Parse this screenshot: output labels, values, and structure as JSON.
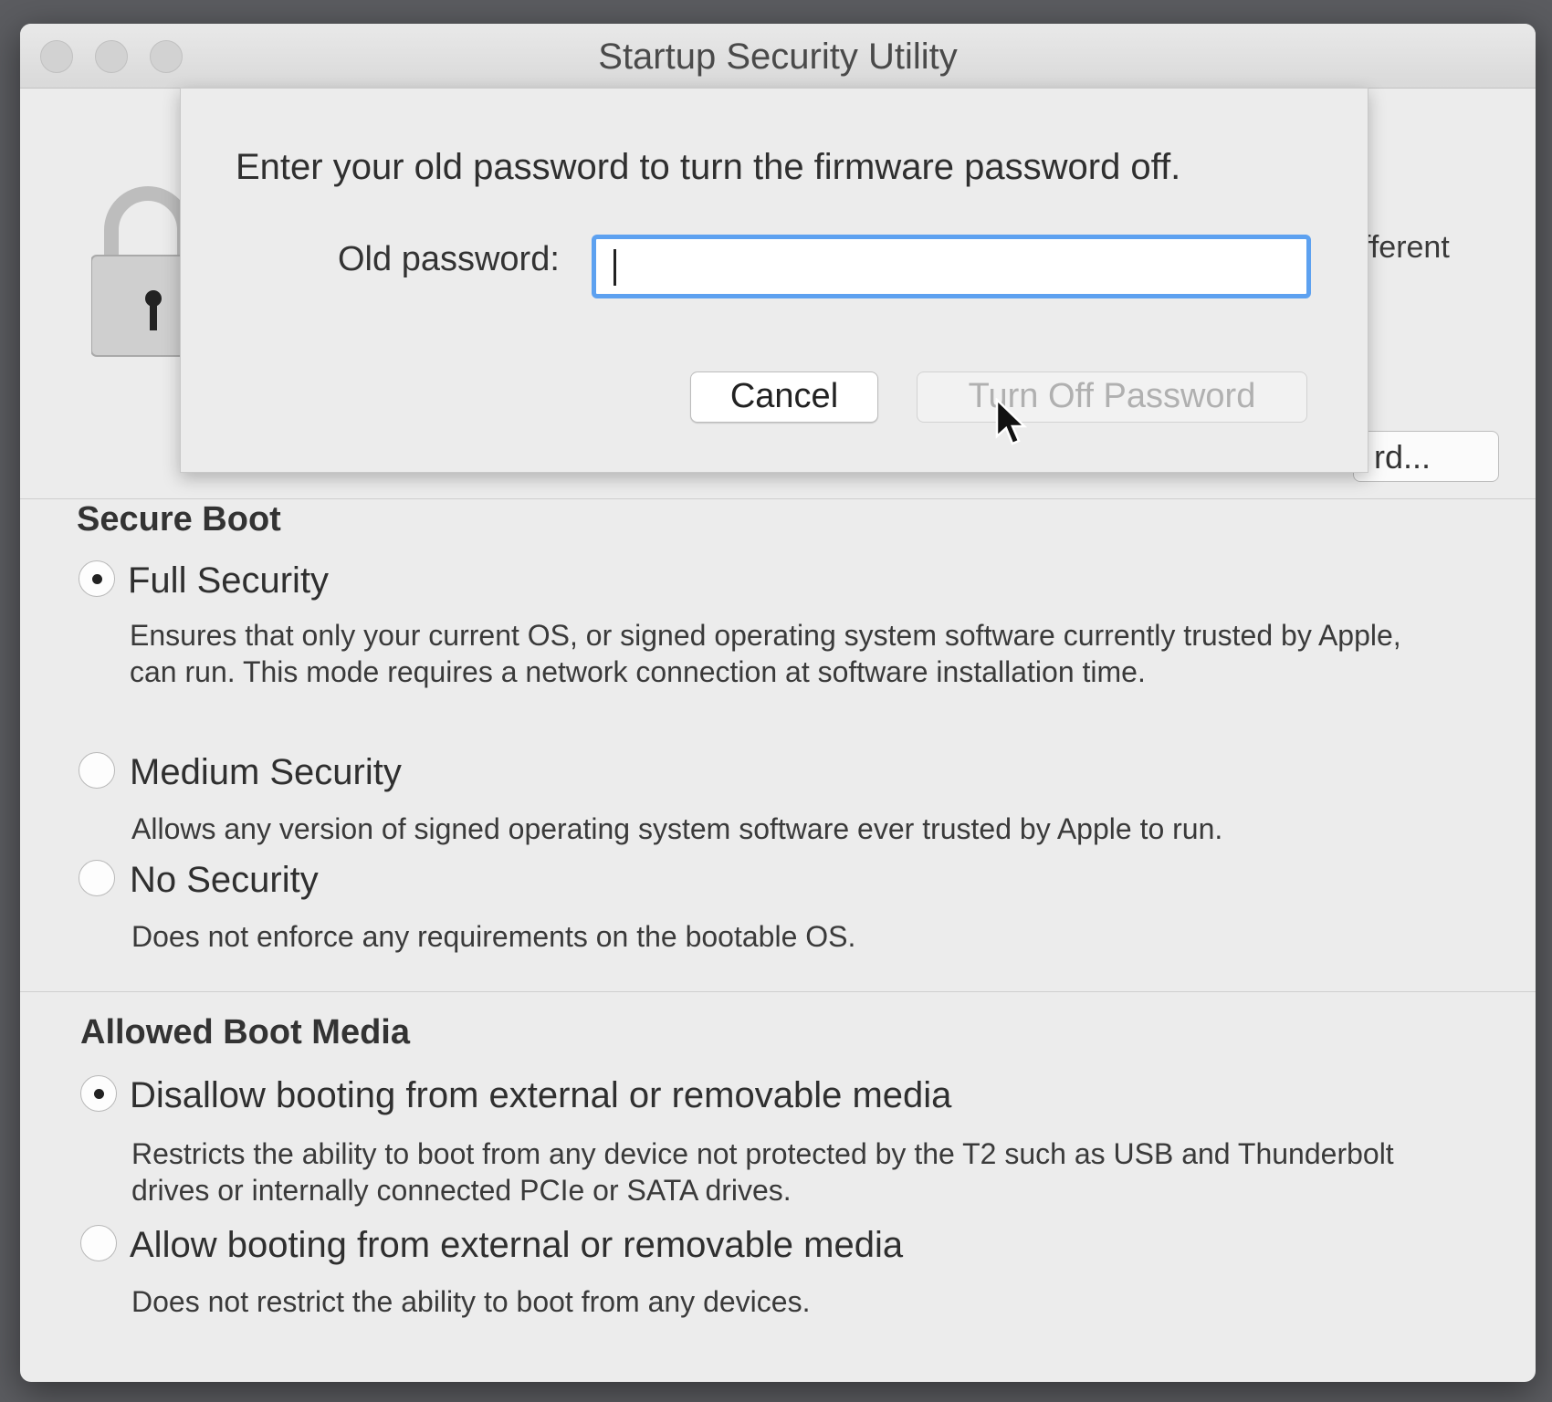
{
  "window": {
    "title": "Startup Security Utility"
  },
  "background": {
    "partial_text": "fferent",
    "partial_button": "rd..."
  },
  "sheet": {
    "message": "Enter your old password to turn the firmware password off.",
    "password_label": "Old password:",
    "password_value": "",
    "cancel_label": "Cancel",
    "turn_off_label": "Turn Off Password",
    "turn_off_enabled": false
  },
  "secure_boot": {
    "title": "Secure Boot",
    "options": [
      {
        "label": "Full Security",
        "description": "Ensures that only your current OS, or signed operating system software currently trusted by Apple, can run. This mode requires a network connection at software installation time.",
        "selected": true
      },
      {
        "label": "Medium Security",
        "description": "Allows any version of signed operating system software ever trusted by Apple to run.",
        "selected": false
      },
      {
        "label": "No Security",
        "description": "Does not enforce any requirements on the bootable OS.",
        "selected": false
      }
    ]
  },
  "boot_media": {
    "title": "Allowed Boot Media",
    "options": [
      {
        "label": "Disallow booting from external or removable media",
        "description": "Restricts the ability to boot from any device not protected by the T2 such as USB and Thunderbolt drives or internally connected PCIe or SATA drives.",
        "selected": true
      },
      {
        "label": "Allow booting from external or removable media",
        "description": "Does not restrict the ability to boot from any devices.",
        "selected": false
      }
    ]
  }
}
